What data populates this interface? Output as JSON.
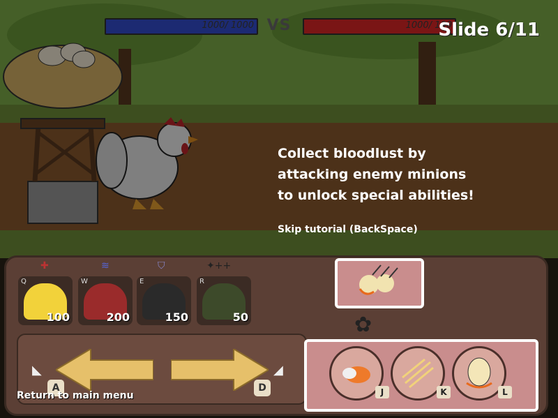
{
  "hud": {
    "player_hp": "1000/ 1000",
    "enemy_hp": "1000/ 100",
    "vs": "VS",
    "slide": "Slide 6/11"
  },
  "tutorial": {
    "message": "Collect bloodlust by\nattacking enemy minions\nto unlock special abilities!",
    "skip": "Skip tutorial (BackSpace)"
  },
  "units": [
    {
      "key": "Q",
      "cost": "100",
      "icon": "duck"
    },
    {
      "key": "W",
      "cost": "200",
      "icon": "turkey"
    },
    {
      "key": "E",
      "cost": "150",
      "icon": "penguin"
    },
    {
      "key": "R",
      "cost": "50",
      "icon": "camo-penguin"
    }
  ],
  "controls": {
    "left_key": "A",
    "right_key": "D",
    "return": "Return to main menu"
  },
  "abilities": [
    {
      "key": "J",
      "icon": "fireball"
    },
    {
      "key": "K",
      "icon": "scratch"
    },
    {
      "key": "L",
      "icon": "egg"
    }
  ],
  "colors": {
    "player_hp": "#1c2a72",
    "enemy_hp": "#7a1515",
    "panel": "#5b3f35",
    "highlight": "#ffffff"
  }
}
